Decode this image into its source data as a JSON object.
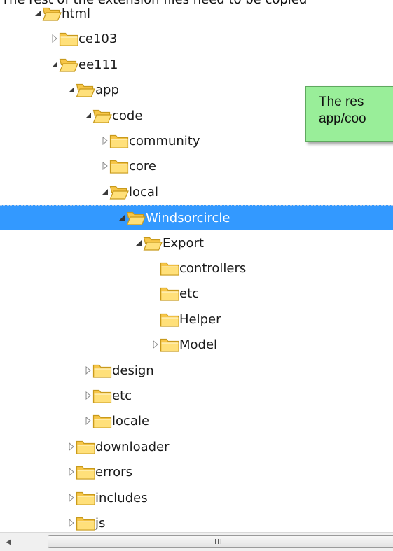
{
  "intro_text": "The rest of the extension files need to be copied",
  "tree": [
    {
      "label": "html",
      "level": 0,
      "toggle": "expanded"
    },
    {
      "label": "ce103",
      "level": 1,
      "toggle": "collapsed"
    },
    {
      "label": "ee111",
      "level": 1,
      "toggle": "expanded"
    },
    {
      "label": "app",
      "level": 2,
      "toggle": "expanded"
    },
    {
      "label": "code",
      "level": 3,
      "toggle": "expanded"
    },
    {
      "label": "community",
      "level": 4,
      "toggle": "collapsed"
    },
    {
      "label": "core",
      "level": 4,
      "toggle": "collapsed"
    },
    {
      "label": "local",
      "level": 4,
      "toggle": "expanded"
    },
    {
      "label": "Windsorcircle",
      "level": 5,
      "toggle": "expanded",
      "selected": true
    },
    {
      "label": "Export",
      "level": 6,
      "toggle": "expanded"
    },
    {
      "label": "controllers",
      "level": 7,
      "toggle": "none"
    },
    {
      "label": "etc",
      "level": 7,
      "toggle": "none"
    },
    {
      "label": "Helper",
      "level": 7,
      "toggle": "none"
    },
    {
      "label": "Model",
      "level": 7,
      "toggle": "collapsed"
    },
    {
      "label": "design",
      "level": 3,
      "toggle": "collapsed"
    },
    {
      "label": "etc",
      "level": 3,
      "toggle": "collapsed"
    },
    {
      "label": "locale",
      "level": 3,
      "toggle": "collapsed"
    },
    {
      "label": "downloader",
      "level": 2,
      "toggle": "collapsed"
    },
    {
      "label": "errors",
      "level": 2,
      "toggle": "collapsed"
    },
    {
      "label": "includes",
      "level": 2,
      "toggle": "collapsed"
    },
    {
      "label": "js",
      "level": 2,
      "toggle": "collapsed"
    }
  ],
  "callout": {
    "line1": "The res",
    "line2": "app/coo"
  },
  "scrollbar": {
    "left_arrow_icon": "arrow-left-icon",
    "grip_label": "III"
  },
  "colors": {
    "selection": "#3399ff",
    "callout_bg": "#99ee99",
    "folder_fill": "#ffd65c",
    "folder_outline": "#c89a1c"
  }
}
